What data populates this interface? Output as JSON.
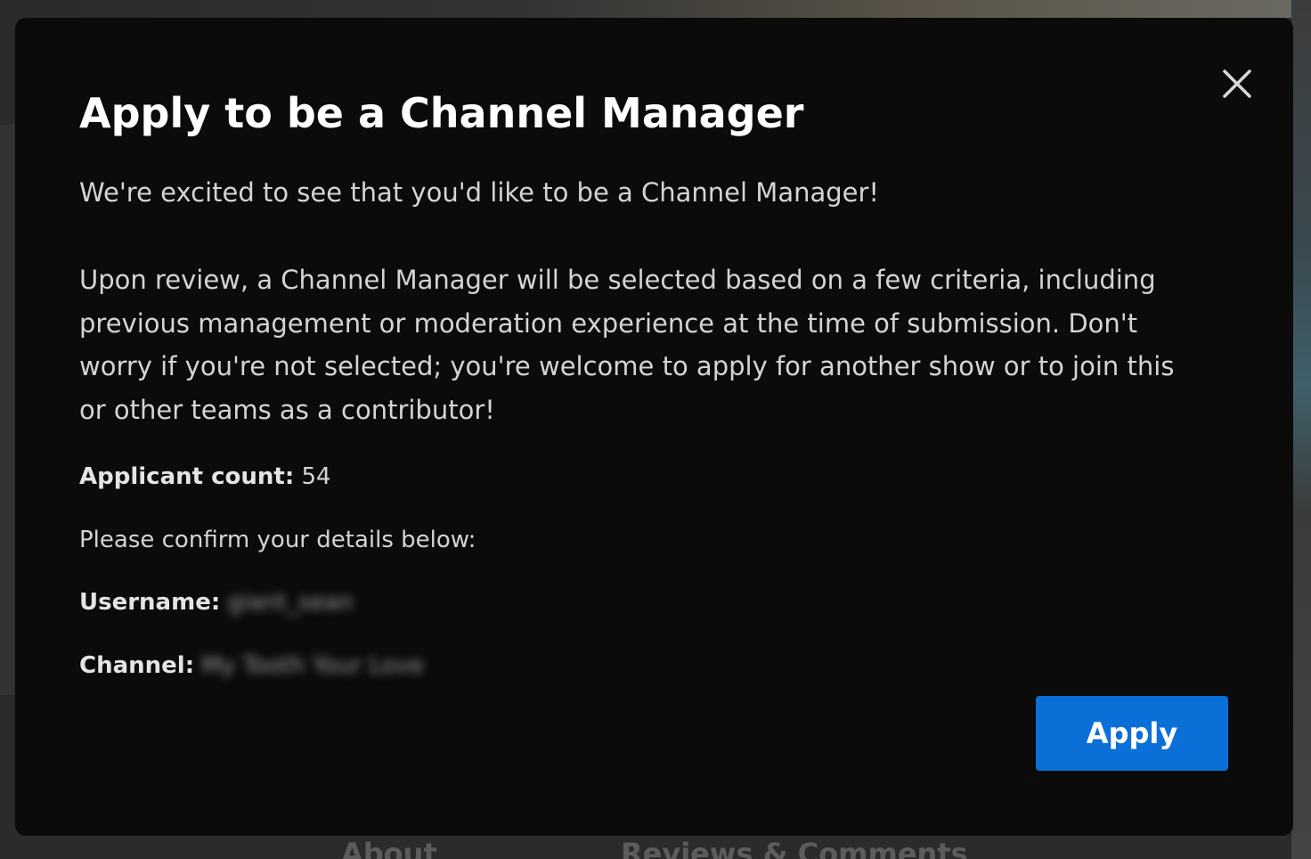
{
  "background": {
    "tabs": [
      {
        "label": "About"
      },
      {
        "label": "Reviews & Comments"
      }
    ]
  },
  "modal": {
    "title": "Apply to be a Channel Manager",
    "intro": "We're excited to see that you'd like to be a Channel Manager!",
    "review_lines": [
      "Upon review, a Channel Manager will be selected based on a few criteria, including",
      "previous management or moderation experience at the time of submission. Don't",
      "worry if you're not selected; you're welcome to apply for another show or to join this",
      "or other teams as a contributor!"
    ],
    "applicant_count_label": "Applicant count:",
    "applicant_count_value": "54",
    "confirm_text": "Please confirm your details below:",
    "username_label": "Username:",
    "username_value": "giant_sean",
    "channel_label": "Channel:",
    "channel_value": "My Tooth Your Love",
    "apply_label": "Apply",
    "close_icon": "close-icon"
  },
  "colors": {
    "modal_bg": "#0b0b0b",
    "title": "#ffffff",
    "body_text": "#d4d4d4",
    "primary_button": "#0b6fd8"
  }
}
